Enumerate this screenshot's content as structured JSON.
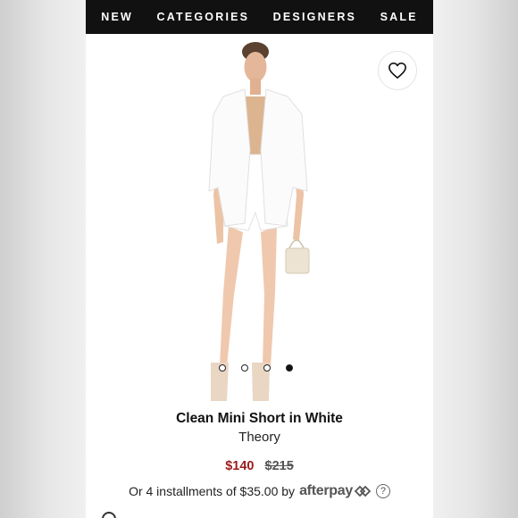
{
  "nav": {
    "items": [
      "NEW",
      "CATEGORIES",
      "DESIGNERS",
      "SALE"
    ]
  },
  "gallery": {
    "image_count": 4,
    "active_index": 3
  },
  "product": {
    "title": "Clean Mini Short in White",
    "brand": "Theory",
    "sale_price": "$140",
    "original_price": "$215",
    "installments_text": "Or 4 installments of $35.00 by",
    "payment_provider": "afterpay",
    "help_glyph": "?"
  },
  "colors": {
    "nav_bg": "#111111",
    "sale_price": "#9b1c1c",
    "page_bg": "#ffffff"
  },
  "icons": {
    "wishlist": "heart-icon",
    "afterpay": "afterpay-arrows-icon",
    "help": "help-circle-icon"
  }
}
